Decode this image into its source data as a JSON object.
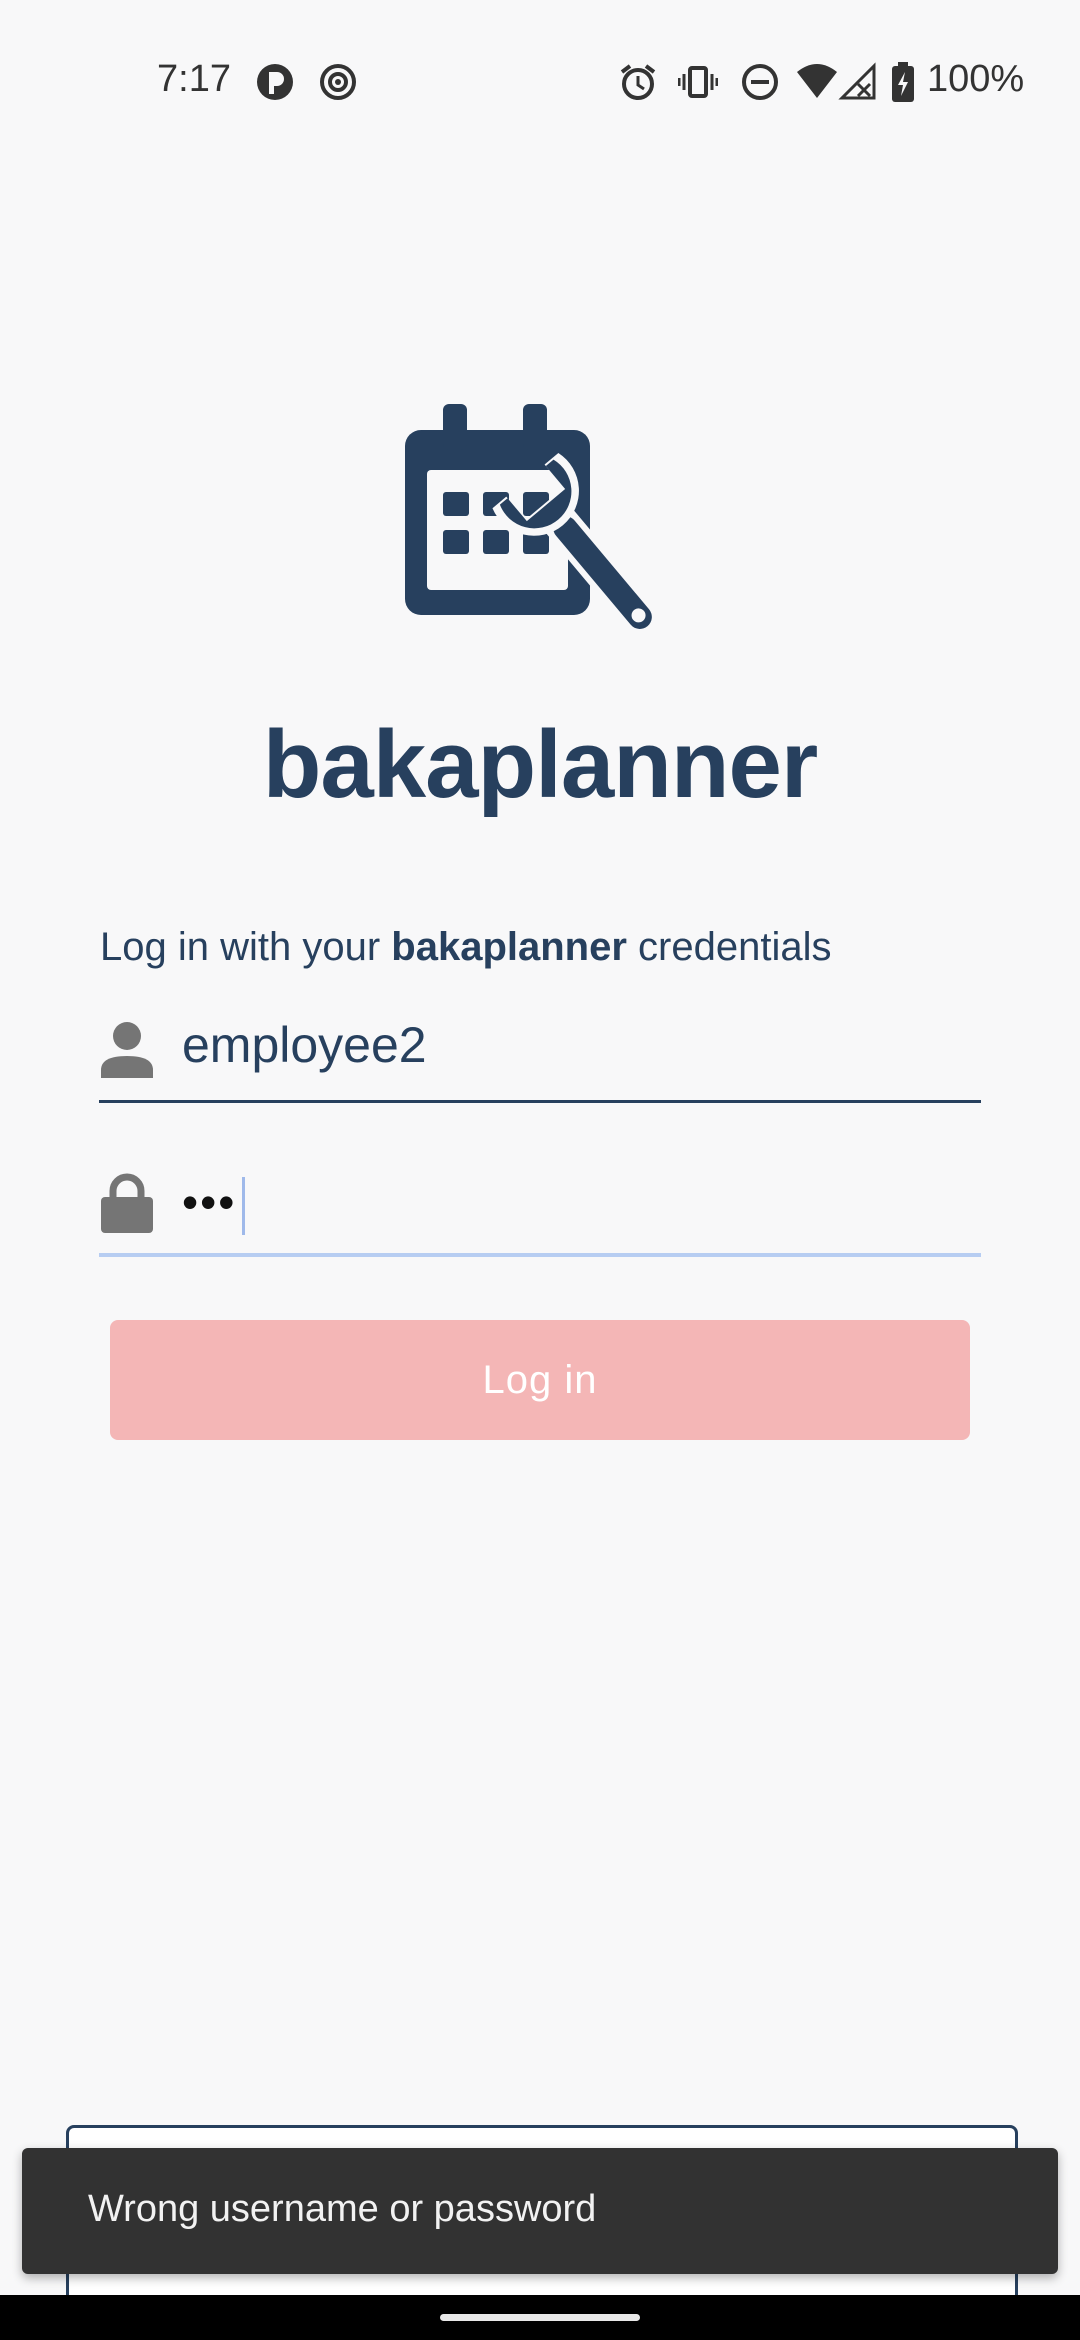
{
  "status_bar": {
    "time": "7:17",
    "battery": "100%",
    "icons": [
      "app-icon",
      "radar-icon",
      "alarm-icon",
      "vibrate-icon",
      "dnd-icon",
      "wifi-icon",
      "signal-icon",
      "battery-charging-icon"
    ]
  },
  "app": {
    "name": "bakaplanner",
    "logo_icon": "calendar-wrench-icon",
    "brand_color": "#27405e"
  },
  "login": {
    "prompt_prefix": "Log in with your ",
    "prompt_brand": "bakaplanner",
    "prompt_suffix": " credentials",
    "username_value": "employee2",
    "password_mask": "•••",
    "button_label": "Log in",
    "button_color": "#f4b6b6"
  },
  "snackbar": {
    "message": "Wrong username or password"
  }
}
